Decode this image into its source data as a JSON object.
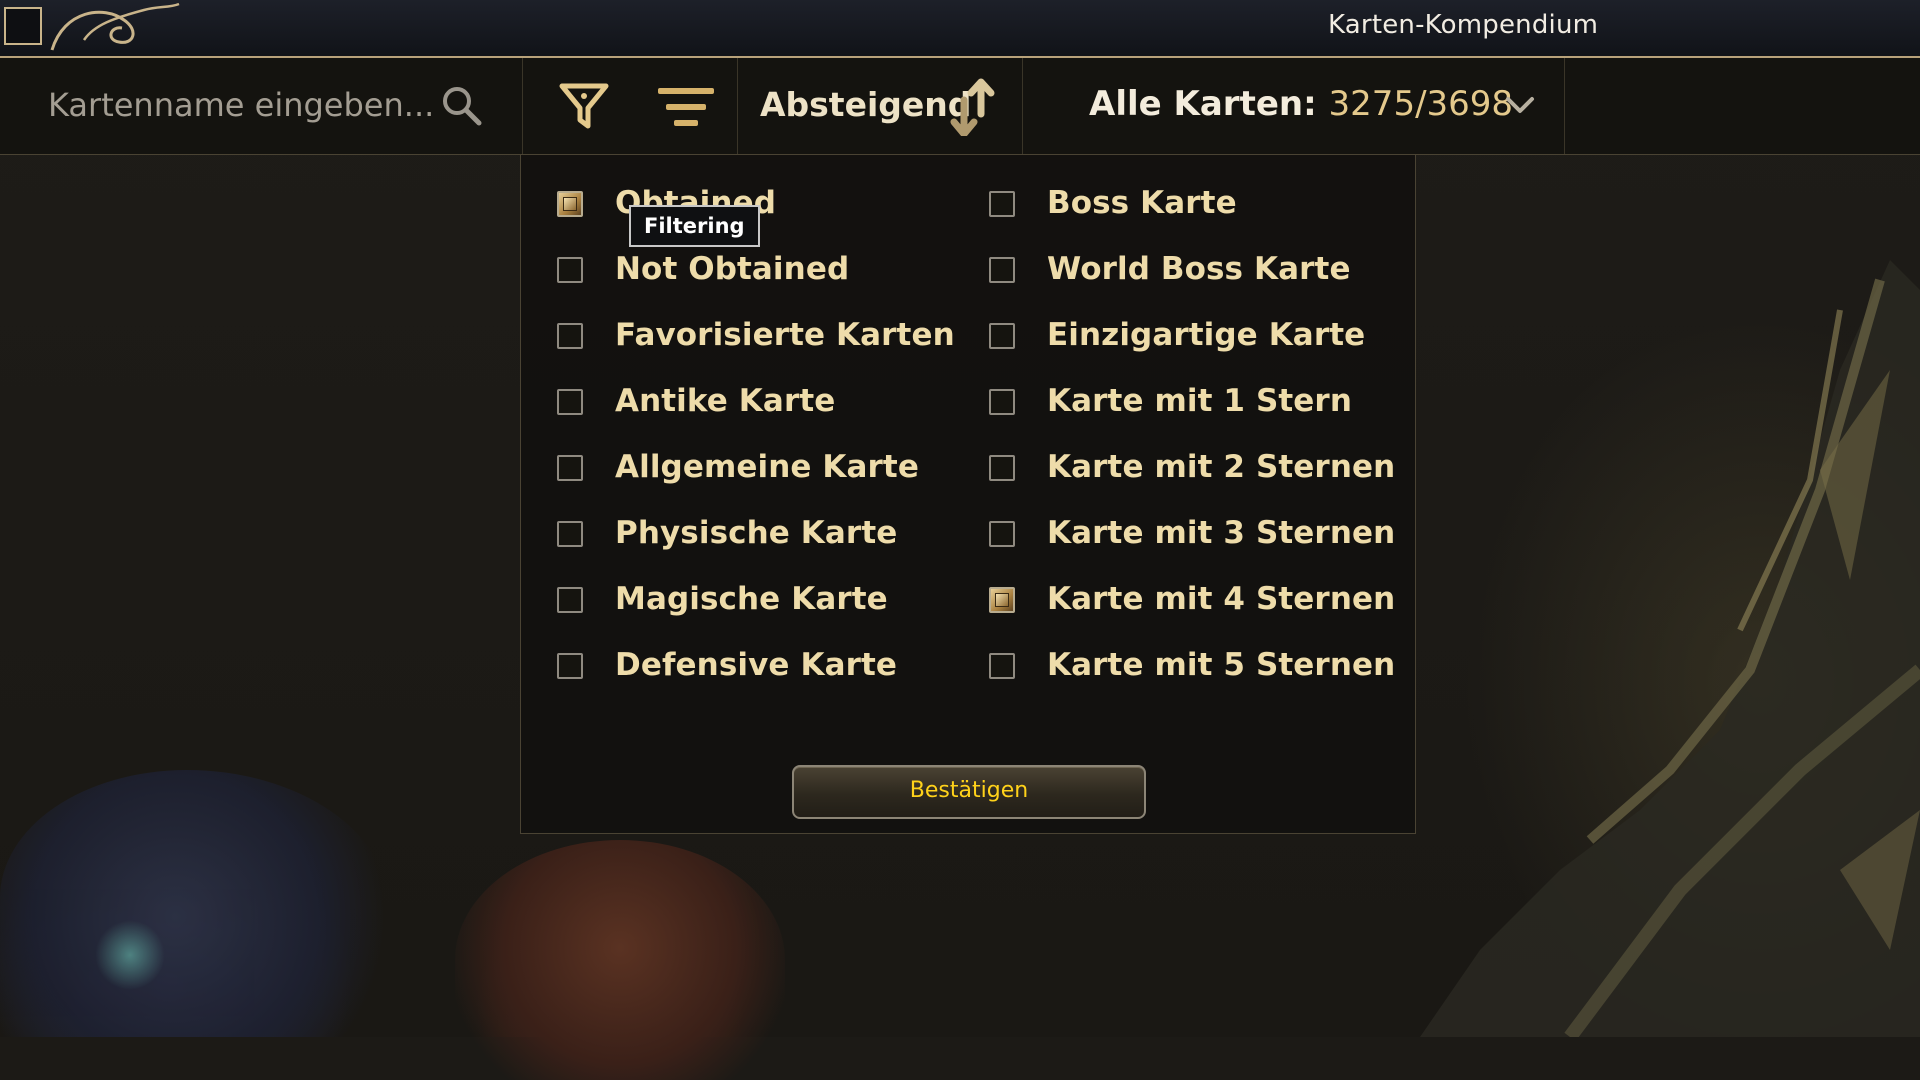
{
  "window": {
    "title": "Karten-Kompendium"
  },
  "toolbar": {
    "search_placeholder": "Kartenname eingeben...",
    "sort_label": "Absteigend",
    "all_cards_label": "Alle Karten:",
    "all_cards_count": "3275/3698"
  },
  "filter_panel": {
    "tooltip": "Filtering",
    "left_column": [
      {
        "label": "Obtained",
        "checked": true
      },
      {
        "label": "Not Obtained",
        "checked": false
      },
      {
        "label": "Favorisierte Karten",
        "checked": false
      },
      {
        "label": "Antike Karte",
        "checked": false
      },
      {
        "label": "Allgemeine Karte",
        "checked": false
      },
      {
        "label": "Physische Karte",
        "checked": false
      },
      {
        "label": "Magische Karte",
        "checked": false
      },
      {
        "label": "Defensive Karte",
        "checked": false
      }
    ],
    "right_column": [
      {
        "label": "Boss Karte",
        "checked": false
      },
      {
        "label": "World Boss Karte",
        "checked": false
      },
      {
        "label": "Einzigartige Karte",
        "checked": false
      },
      {
        "label": "Karte mit 1 Stern",
        "checked": false
      },
      {
        "label": "Karte mit 2 Sternen",
        "checked": false
      },
      {
        "label": "Karte mit 3 Sternen",
        "checked": false
      },
      {
        "label": "Karte mit 4 Sternen",
        "checked": true
      },
      {
        "label": "Karte mit 5 Sternen",
        "checked": false
      }
    ],
    "confirm_label": "Bestätigen"
  },
  "icons": {
    "search": "search-icon",
    "filter": "filter-icon",
    "sort_lines": "sort-lines-icon",
    "sort_arrows": "sort-arrows-icon",
    "dropdown": "chevron-down-icon"
  },
  "colors": {
    "accent_gold": "#eedcaa",
    "count_gold": "#e4c98c",
    "confirm_text": "#ffd21a",
    "checked_fill": "#c9a867"
  }
}
